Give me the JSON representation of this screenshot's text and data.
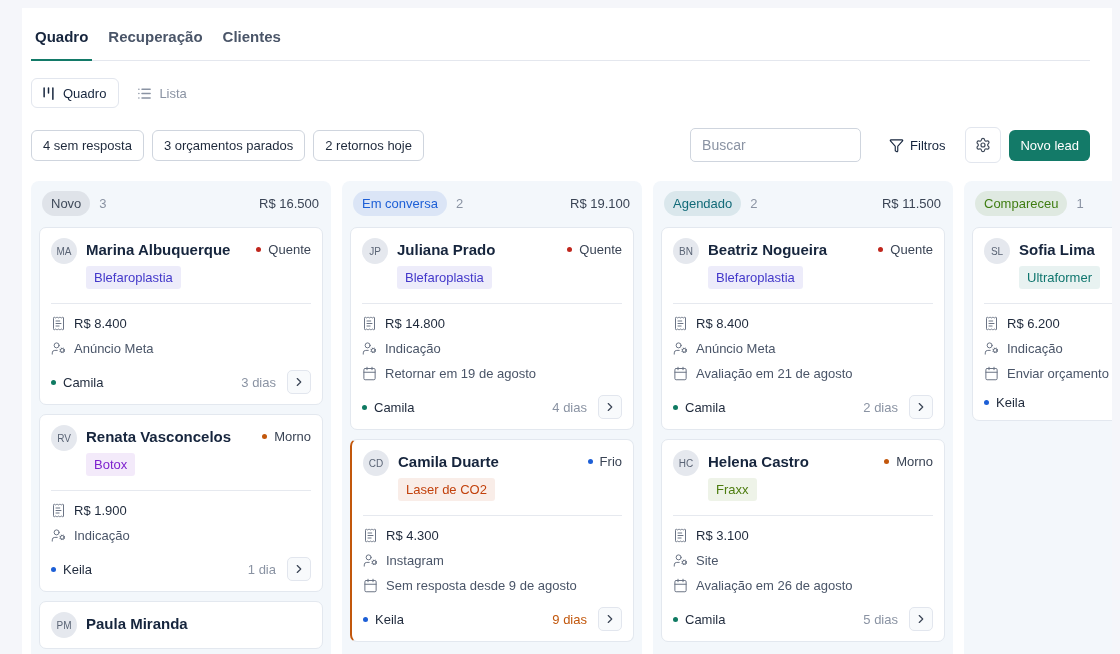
{
  "tabs": [
    {
      "label": "Quadro",
      "selected": true
    },
    {
      "label": "Recuperação",
      "selected": false
    },
    {
      "label": "Clientes",
      "selected": false
    }
  ],
  "views": [
    {
      "label": "Quadro",
      "kind": "board",
      "selected": true
    },
    {
      "label": "Lista",
      "kind": "list",
      "selected": false
    }
  ],
  "quick_filters": [
    "4 sem resposta",
    "3 orçamentos parados",
    "2 retornos hoje"
  ],
  "search": {
    "placeholder": "Buscar"
  },
  "filters_button": "Filtros",
  "new_button": "Novo lead",
  "columns": [
    {
      "title": "Novo",
      "count": "3",
      "total": "R$ 16.500",
      "color": "#3f4a5a",
      "cards": [
        {
          "initials": "MA",
          "name": "Marina Albuquerque",
          "temperature": {
            "label": "Quente",
            "color": "#c0261d"
          },
          "tag": {
            "label": "Blefaroplastia",
            "color": "#4338ca"
          },
          "value": "R$ 8.400",
          "source": "Anúncio Meta",
          "owner": {
            "name": "Camila",
            "color": "#0f7a62"
          },
          "age": "3 dias",
          "overdue": false
        },
        {
          "initials": "RV",
          "name": "Renata Vasconcelos",
          "temperature": {
            "label": "Morno",
            "color": "#c2570c"
          },
          "tag": {
            "label": "Botox",
            "color": "#7e22ce"
          },
          "value": "R$ 1.900",
          "source": "Indicação",
          "owner": {
            "name": "Keila",
            "color": "#1d5fd6"
          },
          "age": "1 dia",
          "overdue": false
        },
        {
          "initials": "PM",
          "name": "Paula Miranda"
        }
      ]
    },
    {
      "title": "Em conversa",
      "count": "2",
      "total": "R$ 19.100",
      "color": "#1d5fd6",
      "cards": [
        {
          "initials": "JP",
          "name": "Juliana Prado",
          "temperature": {
            "label": "Quente",
            "color": "#c0261d"
          },
          "tag": {
            "label": "Blefaroplastia",
            "color": "#4338ca"
          },
          "value": "R$ 14.800",
          "source": "Indicação",
          "date": "Retornar em 19 de agosto",
          "owner": {
            "name": "Camila",
            "color": "#0f7a62"
          },
          "age": "4 dias",
          "overdue": false
        },
        {
          "initials": "CD",
          "name": "Camila Duarte",
          "temperature": {
            "label": "Frio",
            "color": "#1d5fd6"
          },
          "tag": {
            "label": "Laser de CO2",
            "color": "#c2410c"
          },
          "value": "R$ 4.300",
          "source": "Instagram",
          "date": "Sem resposta desde 9 de agosto",
          "owner": {
            "name": "Keila",
            "color": "#1d5fd6"
          },
          "age": "9 dias",
          "overdue": true
        }
      ]
    },
    {
      "title": "Agendado",
      "count": "2",
      "total": "R$ 11.500",
      "color": "#116a78",
      "cards": [
        {
          "initials": "BN",
          "name": "Beatriz Nogueira",
          "temperature": {
            "label": "Quente",
            "color": "#c0261d"
          },
          "tag": {
            "label": "Blefaroplastia",
            "color": "#4338ca"
          },
          "value": "R$ 8.400",
          "source": "Anúncio Meta",
          "date": "Avaliação em 21 de agosto",
          "owner": {
            "name": "Camila",
            "color": "#0f7a62"
          },
          "age": "2 dias",
          "overdue": false
        },
        {
          "initials": "HC",
          "name": "Helena Castro",
          "temperature": {
            "label": "Morno",
            "color": "#c2570c"
          },
          "tag": {
            "label": "Fraxx",
            "color": "#4d7c0f"
          },
          "value": "R$ 3.100",
          "source": "Site",
          "date": "Avaliação em 26 de agosto",
          "owner": {
            "name": "Camila",
            "color": "#0f7a62"
          },
          "age": "5 dias",
          "overdue": false
        }
      ]
    },
    {
      "title": "Compareceu",
      "count": "1",
      "color": "#3f7d12",
      "cards": [
        {
          "initials": "SL",
          "name": "Sofia Lima",
          "tag": {
            "label": "Ultraformer",
            "color": "#0f766e"
          },
          "value": "R$ 6.200",
          "source": "Indicação",
          "date": "Enviar orçamento",
          "owner": {
            "name": "Keila",
            "color": "#1d5fd6"
          }
        }
      ]
    }
  ]
}
